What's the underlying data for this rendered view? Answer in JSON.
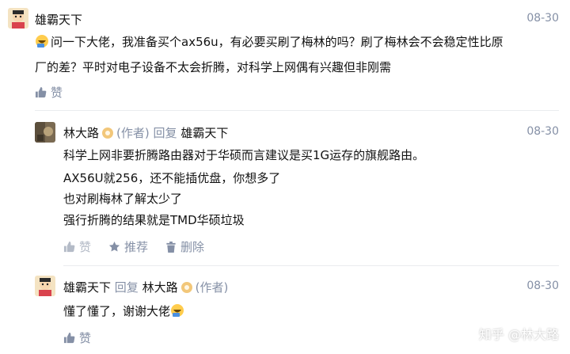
{
  "comments": [
    {
      "author": "雄霸天下",
      "date": "08-30",
      "lines": [
        "问一下大佬，我准备买个ax56u，有必要买刷了梅林的吗？刷了梅林会不会稳定性比原",
        "厂的差？平时对电子设备不太会折腾，对科学上网偶有兴趣但非刚需"
      ],
      "like_label": "赞"
    },
    {
      "author": "林大路",
      "author_tag": "(作者)",
      "reply_word": "回复",
      "reply_to": "雄霸天下",
      "date": "08-30",
      "lines": [
        "科学上网非要折腾路由器对于华硕而言建议是买1G运存的旗舰路由。",
        "AX56U就256，还不能插优盘，你想多了",
        "也对刷梅林了解太少了",
        "强行折腾的结果就是TMD华硕垃圾"
      ],
      "like_label": "赞",
      "recommend_label": "推荐",
      "delete_label": "删除"
    },
    {
      "author": "雄霸天下",
      "reply_word": "回复",
      "reply_to": "林大路",
      "reply_to_tag": "(作者)",
      "date": "08-30",
      "text": "懂了懂了，谢谢大佬",
      "like_label": "赞"
    }
  ],
  "watermark": "知乎 @林大路",
  "colors": {
    "meta": "#8590a6",
    "text": "#121212",
    "divider": "#eaecef"
  }
}
